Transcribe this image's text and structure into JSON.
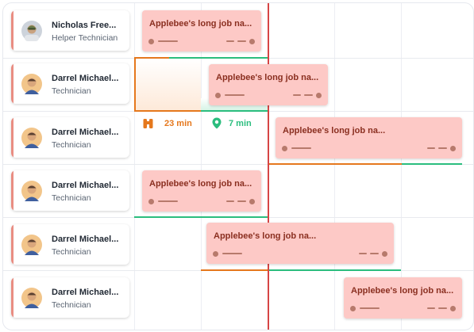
{
  "technicians": [
    {
      "name": "Nicholas Free...",
      "role": "Helper Technician"
    },
    {
      "name": "Darrel Michael...",
      "role": "Technician"
    },
    {
      "name": "Darrel Michael...",
      "role": "Technician"
    },
    {
      "name": "Darrel Michael...",
      "role": "Technician"
    },
    {
      "name": "Darrel Michael...",
      "role": "Technician"
    },
    {
      "name": "Darrel Michael...",
      "role": "Technician"
    }
  ],
  "jobs": [
    {
      "title": "Applebee's long job na..."
    },
    {
      "title": "Applebee's long job na..."
    },
    {
      "title": "Applebee's long job na..."
    },
    {
      "title": "Applebee's long job na..."
    },
    {
      "title": "Applebee's long job na..."
    },
    {
      "title": "Applebee's long job na..."
    }
  ],
  "travel": {
    "drive_time": "23 min",
    "arrival_time": "7 min"
  },
  "colors": {
    "accent": "#e98d82",
    "job_bg": "#fdc9c6",
    "job_text": "#8a2f20",
    "now_line": "#d64545",
    "drive": "#e5781d",
    "arrive": "#2bbd7e"
  },
  "icons": {
    "avatar": "technician-avatar-icon",
    "drive": "binoculars-icon",
    "arrive": "map-pin-icon"
  }
}
